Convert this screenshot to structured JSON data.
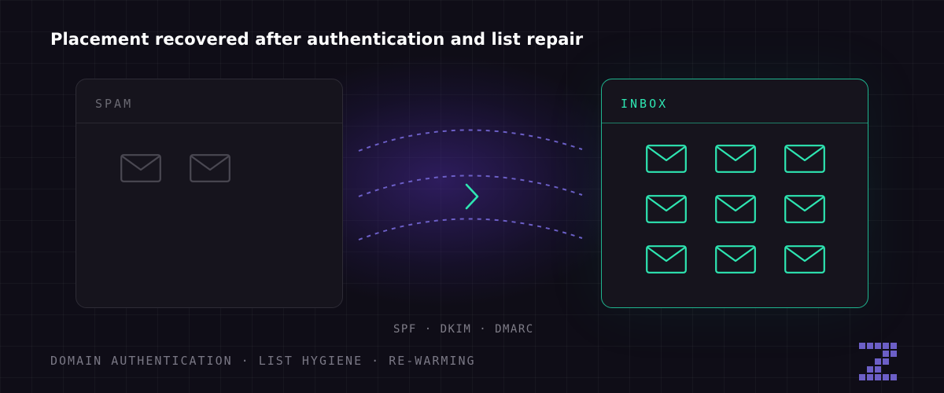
{
  "title": "Placement recovered after authentication and list repair",
  "spam_panel": {
    "label": "SPAM",
    "envelope_count": 2,
    "envelope_color": "#4a4852"
  },
  "inbox_panel": {
    "label": "INBOX",
    "envelope_count": 9,
    "envelope_color": "#2ee6b2"
  },
  "transition": {
    "arrow_icon": "chevron-right-icon",
    "arrow_color": "#2ee6b2",
    "wave_color": "#6c5fc7"
  },
  "auth_label": "SPF · DKIM · DMARC",
  "footer_label": "DOMAIN AUTHENTICATION · LIST HYGIENE · RE-WARMING",
  "logo": {
    "icon": "z-logo-icon",
    "color": "#6c5fc7"
  },
  "colors": {
    "background": "#0f0d17",
    "accent": "#2ee6b2",
    "muted": "#6b6a73"
  }
}
